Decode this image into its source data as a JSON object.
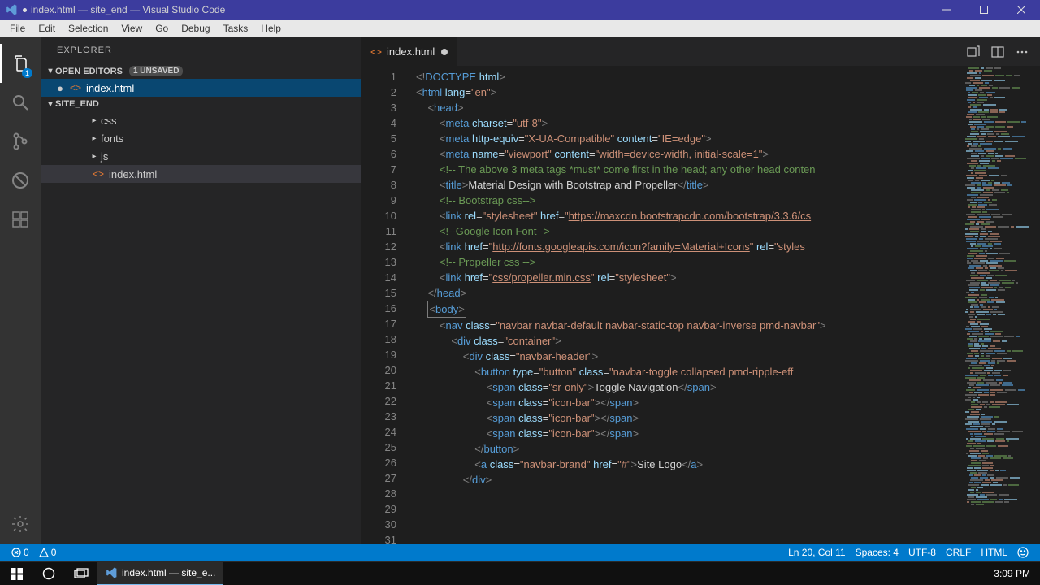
{
  "window": {
    "title": "index.html — site_end — Visual Studio Code"
  },
  "menu": [
    "File",
    "Edit",
    "Selection",
    "View",
    "Go",
    "Debug",
    "Tasks",
    "Help"
  ],
  "activity": {
    "explorer_badge": "1"
  },
  "sidebar": {
    "title": "EXPLORER",
    "open_editors_label": "OPEN EDITORS",
    "unsaved_label": "1 UNSAVED",
    "open_editors": [
      {
        "name": "index.html",
        "modified": true
      }
    ],
    "workspace_label": "SITE_END",
    "folders": [
      {
        "name": "css"
      },
      {
        "name": "fonts"
      },
      {
        "name": "js"
      }
    ],
    "files": [
      {
        "name": "index.html"
      }
    ]
  },
  "tab": {
    "filename": "index.html"
  },
  "code_lines": [
    {
      "n": 1,
      "indent": 0,
      "segs": [
        [
          "punc",
          "<!"
        ],
        [
          "tag",
          "DOCTYPE "
        ],
        [
          "attr",
          "html"
        ],
        [
          "punc",
          ">"
        ]
      ]
    },
    {
      "n": 2,
      "indent": 0,
      "segs": [
        [
          "punc",
          "<"
        ],
        [
          "tag",
          "html "
        ],
        [
          "attr",
          "lang"
        ],
        [
          "txt",
          "="
        ],
        [
          "str",
          "\"en\""
        ],
        [
          "punc",
          ">"
        ]
      ]
    },
    {
      "n": 3,
      "indent": 1,
      "segs": [
        [
          "punc",
          "<"
        ],
        [
          "tag",
          "head"
        ],
        [
          "punc",
          ">"
        ]
      ]
    },
    {
      "n": 4,
      "indent": 2,
      "segs": [
        [
          "punc",
          "<"
        ],
        [
          "tag",
          "meta "
        ],
        [
          "attr",
          "charset"
        ],
        [
          "txt",
          "="
        ],
        [
          "str",
          "\"utf-8\""
        ],
        [
          "punc",
          ">"
        ]
      ]
    },
    {
      "n": 5,
      "indent": 2,
      "segs": [
        [
          "punc",
          "<"
        ],
        [
          "tag",
          "meta "
        ],
        [
          "attr",
          "http-equiv"
        ],
        [
          "txt",
          "="
        ],
        [
          "str",
          "\"X-UA-Compatible\" "
        ],
        [
          "attr",
          "content"
        ],
        [
          "txt",
          "="
        ],
        [
          "str",
          "\"IE=edge\""
        ],
        [
          "punc",
          ">"
        ]
      ]
    },
    {
      "n": 6,
      "indent": 2,
      "segs": [
        [
          "punc",
          "<"
        ],
        [
          "tag",
          "meta "
        ],
        [
          "attr",
          "name"
        ],
        [
          "txt",
          "="
        ],
        [
          "str",
          "\"viewport\" "
        ],
        [
          "attr",
          "content"
        ],
        [
          "txt",
          "="
        ],
        [
          "str",
          "\"width=device-width, initial-scale=1\""
        ],
        [
          "punc",
          ">"
        ]
      ]
    },
    {
      "n": 7,
      "indent": 2,
      "segs": [
        [
          "comment",
          "<!-- The above 3 meta tags *must* come first in the head; any other head conten"
        ]
      ]
    },
    {
      "n": 8,
      "indent": 2,
      "segs": [
        [
          "punc",
          "<"
        ],
        [
          "tag",
          "title"
        ],
        [
          "punc",
          ">"
        ],
        [
          "txt",
          "Material Design with Bootstrap and Propeller"
        ],
        [
          "punc",
          "</"
        ],
        [
          "tag",
          "title"
        ],
        [
          "punc",
          ">"
        ]
      ]
    },
    {
      "n": 9,
      "indent": 0,
      "segs": []
    },
    {
      "n": 10,
      "indent": 2,
      "segs": [
        [
          "comment",
          "<!-- Bootstrap css-->"
        ]
      ]
    },
    {
      "n": 11,
      "indent": 2,
      "segs": [
        [
          "punc",
          "<"
        ],
        [
          "tag",
          "link "
        ],
        [
          "attr",
          "rel"
        ],
        [
          "txt",
          "="
        ],
        [
          "str",
          "\"stylesheet\" "
        ],
        [
          "attr",
          "href"
        ],
        [
          "txt",
          "="
        ],
        [
          "str",
          "\""
        ],
        [
          "link",
          "https://maxcdn.bootstrapcdn.com/bootstrap/3.3.6/cs"
        ]
      ]
    },
    {
      "n": 12,
      "indent": 0,
      "segs": []
    },
    {
      "n": 13,
      "indent": 2,
      "segs": [
        [
          "comment",
          "<!--Google Icon Font-->"
        ]
      ]
    },
    {
      "n": 14,
      "indent": 2,
      "segs": [
        [
          "punc",
          "<"
        ],
        [
          "tag",
          "link "
        ],
        [
          "attr",
          "href"
        ],
        [
          "txt",
          "="
        ],
        [
          "str",
          "\""
        ],
        [
          "link",
          "http://fonts.googleapis.com/icon?family=Material+Icons"
        ],
        [
          "str",
          "\" "
        ],
        [
          "attr",
          "rel"
        ],
        [
          "txt",
          "="
        ],
        [
          "str",
          "\"styles"
        ]
      ]
    },
    {
      "n": 15,
      "indent": 0,
      "segs": []
    },
    {
      "n": 16,
      "indent": 2,
      "segs": [
        [
          "comment",
          "<!-- Propeller css -->"
        ]
      ]
    },
    {
      "n": 17,
      "indent": 2,
      "segs": [
        [
          "punc",
          "<"
        ],
        [
          "tag",
          "link "
        ],
        [
          "attr",
          "href"
        ],
        [
          "txt",
          "="
        ],
        [
          "str",
          "\""
        ],
        [
          "link",
          "css/propeller.min.css"
        ],
        [
          "str",
          "\" "
        ],
        [
          "attr",
          "rel"
        ],
        [
          "txt",
          "="
        ],
        [
          "str",
          "\"stylesheet\""
        ],
        [
          "punc",
          ">"
        ]
      ]
    },
    {
      "n": 18,
      "indent": 1,
      "segs": [
        [
          "punc",
          "</"
        ],
        [
          "tag",
          "head"
        ],
        [
          "punc",
          ">"
        ]
      ]
    },
    {
      "n": 19,
      "indent": 0,
      "segs": []
    },
    {
      "n": 20,
      "indent": 1,
      "cursor": true,
      "segs": [
        [
          "punc",
          "<"
        ],
        [
          "tag",
          "body"
        ],
        [
          "punc",
          ">"
        ]
      ]
    },
    {
      "n": 21,
      "indent": 2,
      "segs": [
        [
          "punc",
          "<"
        ],
        [
          "tag",
          "nav "
        ],
        [
          "attr",
          "class"
        ],
        [
          "txt",
          "="
        ],
        [
          "str",
          "\"navbar navbar-default navbar-static-top navbar-inverse pmd-navbar\""
        ],
        [
          "punc",
          ">"
        ]
      ]
    },
    {
      "n": 22,
      "indent": 3,
      "segs": [
        [
          "punc",
          "<"
        ],
        [
          "tag",
          "div "
        ],
        [
          "attr",
          "class"
        ],
        [
          "txt",
          "="
        ],
        [
          "str",
          "\"container\""
        ],
        [
          "punc",
          ">"
        ]
      ]
    },
    {
      "n": 23,
      "indent": 4,
      "segs": [
        [
          "punc",
          "<"
        ],
        [
          "tag",
          "div "
        ],
        [
          "attr",
          "class"
        ],
        [
          "txt",
          "="
        ],
        [
          "str",
          "\"navbar-header\""
        ],
        [
          "punc",
          ">"
        ]
      ]
    },
    {
      "n": 24,
      "indent": 5,
      "segs": [
        [
          "punc",
          "<"
        ],
        [
          "tag",
          "button "
        ],
        [
          "attr",
          "type"
        ],
        [
          "txt",
          "="
        ],
        [
          "str",
          "\"button\" "
        ],
        [
          "attr",
          "class"
        ],
        [
          "txt",
          "="
        ],
        [
          "str",
          "\"navbar-toggle collapsed pmd-ripple-eff"
        ]
      ]
    },
    {
      "n": 25,
      "indent": 6,
      "segs": [
        [
          "punc",
          "<"
        ],
        [
          "tag",
          "span "
        ],
        [
          "attr",
          "class"
        ],
        [
          "txt",
          "="
        ],
        [
          "str",
          "\"sr-only\""
        ],
        [
          "punc",
          ">"
        ],
        [
          "txt",
          "Toggle Navigation"
        ],
        [
          "punc",
          "</"
        ],
        [
          "tag",
          "span"
        ],
        [
          "punc",
          ">"
        ]
      ]
    },
    {
      "n": 26,
      "indent": 6,
      "segs": [
        [
          "punc",
          "<"
        ],
        [
          "tag",
          "span "
        ],
        [
          "attr",
          "class"
        ],
        [
          "txt",
          "="
        ],
        [
          "str",
          "\"icon-bar\""
        ],
        [
          "punc",
          "></"
        ],
        [
          "tag",
          "span"
        ],
        [
          "punc",
          ">"
        ]
      ]
    },
    {
      "n": 27,
      "indent": 6,
      "segs": [
        [
          "punc",
          "<"
        ],
        [
          "tag",
          "span "
        ],
        [
          "attr",
          "class"
        ],
        [
          "txt",
          "="
        ],
        [
          "str",
          "\"icon-bar\""
        ],
        [
          "punc",
          "></"
        ],
        [
          "tag",
          "span"
        ],
        [
          "punc",
          ">"
        ]
      ]
    },
    {
      "n": 28,
      "indent": 6,
      "segs": [
        [
          "punc",
          "<"
        ],
        [
          "tag",
          "span "
        ],
        [
          "attr",
          "class"
        ],
        [
          "txt",
          "="
        ],
        [
          "str",
          "\"icon-bar\""
        ],
        [
          "punc",
          "></"
        ],
        [
          "tag",
          "span"
        ],
        [
          "punc",
          ">"
        ]
      ]
    },
    {
      "n": 29,
      "indent": 5,
      "segs": [
        [
          "punc",
          "</"
        ],
        [
          "tag",
          "button"
        ],
        [
          "punc",
          ">"
        ]
      ]
    },
    {
      "n": 30,
      "indent": 5,
      "segs": [
        [
          "punc",
          "<"
        ],
        [
          "tag",
          "a "
        ],
        [
          "attr",
          "class"
        ],
        [
          "txt",
          "="
        ],
        [
          "str",
          "\"navbar-brand\" "
        ],
        [
          "attr",
          "href"
        ],
        [
          "txt",
          "="
        ],
        [
          "str",
          "\"#\""
        ],
        [
          "punc",
          ">"
        ],
        [
          "txt",
          "Site Logo"
        ],
        [
          "punc",
          "</"
        ],
        [
          "tag",
          "a"
        ],
        [
          "punc",
          ">"
        ]
      ]
    },
    {
      "n": 31,
      "indent": 4,
      "segs": [
        [
          "punc",
          "</"
        ],
        [
          "tag",
          "div"
        ],
        [
          "punc",
          ">"
        ]
      ]
    }
  ],
  "status": {
    "errors": "0",
    "warnings": "0",
    "position": "Ln 20, Col 11",
    "spaces": "Spaces: 4",
    "encoding": "UTF-8",
    "eol": "CRLF",
    "language": "HTML"
  },
  "taskbar": {
    "app": "index.html — site_e...",
    "clock": "3:09 PM"
  }
}
